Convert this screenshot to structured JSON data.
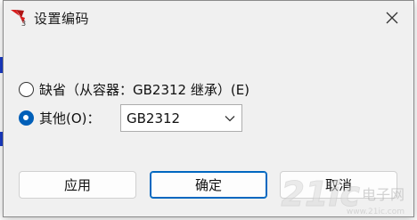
{
  "window": {
    "title": "设置编码",
    "icon": "app-logo-icon",
    "close_icon": "close-icon"
  },
  "options": [
    {
      "label": "缺省（从容器：GB2312 继承）(E)",
      "checked": false
    },
    {
      "label": "其他(O)：",
      "checked": true
    }
  ],
  "encoding_select": {
    "value": "GB2312"
  },
  "buttons": {
    "apply": "应用",
    "ok": "确定",
    "cancel": "取消"
  },
  "watermark": {
    "logo_text": "21ic",
    "text": "电子网",
    "site": "www.21ic.com"
  },
  "colors": {
    "accent": "#005fb8",
    "default_button_border": "#0067c0",
    "dialog_bg": "#f0f0f0"
  }
}
